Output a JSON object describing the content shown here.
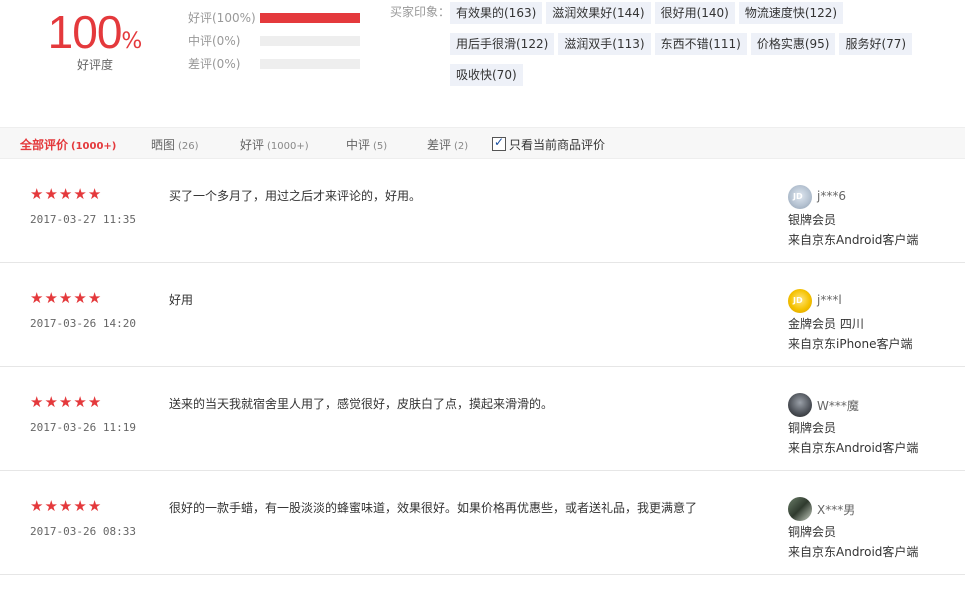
{
  "summary": {
    "rate_value": "100",
    "rate_unit": "%",
    "rate_label": "好评度",
    "bars": [
      {
        "label": "好评(100%)",
        "fraction": 1.0
      },
      {
        "label": "中评(0%)",
        "fraction": 0.0
      },
      {
        "label": "差评(0%)",
        "fraction": 0.0
      }
    ],
    "impression_label": "买家印象：",
    "tags": [
      "有效果的(163)",
      "滋润效果好(144)",
      "很好用(140)",
      "物流速度快(122)",
      "用后手很滑(122)",
      "滋润双手(113)",
      "东西不错(111)",
      "价格实惠(95)",
      "服务好(77)",
      "吸收快(70)"
    ]
  },
  "filter": {
    "tabs": [
      {
        "label": "全部评价",
        "count": "(1000+)"
      },
      {
        "label": "晒图",
        "count": "(26)"
      },
      {
        "label": "好评",
        "count": "(1000+)"
      },
      {
        "label": "中评",
        "count": "(5)"
      },
      {
        "label": "差评",
        "count": "(2)"
      }
    ],
    "only_current_label": "只看当前商品评价",
    "only_current_checked": true
  },
  "reviews": [
    {
      "stars": 5,
      "date": "2017-03-27 11:35",
      "content": "买了一个多月了，用过之后才来评论的，好用。",
      "user": "j***6",
      "level": "银牌会员",
      "client": "来自京东Android客户端",
      "avatar_icon": "jd-silver-avatar-icon",
      "avatar_badge": "JD"
    },
    {
      "stars": 5,
      "date": "2017-03-26 14:20",
      "content": "好用",
      "user": "j***l",
      "level": "金牌会员  四川",
      "client": "来自京东iPhone客户端",
      "avatar_icon": "jd-gold-avatar-icon",
      "avatar_badge": "JD"
    },
    {
      "stars": 5,
      "date": "2017-03-26 11:19",
      "content": "送来的当天我就宿舍里人用了，感觉很好，皮肤白了点，摸起来滑滑的。",
      "user": "W***魔",
      "level": "铜牌会员",
      "client": "来自京东Android客户端",
      "avatar_icon": "user-photo-avatar-icon",
      "avatar_badge": ""
    },
    {
      "stars": 5,
      "date": "2017-03-26 08:33",
      "content": "很好的一款手蜡，有一股淡淡的蜂蜜味道，效果很好。如果价格再优惠些，或者送礼品，我更满意了",
      "user": "X***男",
      "level": "铜牌会员",
      "client": "来自京东Android客户端",
      "avatar_icon": "user-photo-avatar-icon",
      "avatar_badge": ""
    }
  ],
  "star_glyph": "★",
  "accent_color": "#e4393c"
}
